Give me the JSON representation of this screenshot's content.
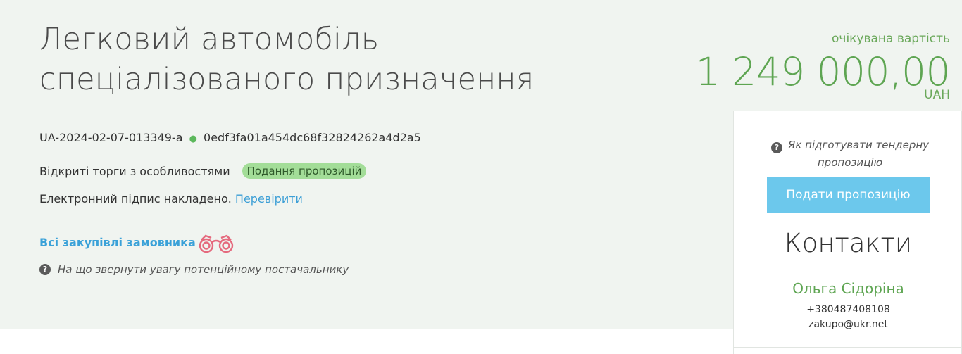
{
  "tender": {
    "title": "Легковий автомобіль спеціалізованого призначення",
    "tender_id": "UA-2024-02-07-013349-a",
    "separator": "●",
    "hash": "0edf3fa01a454dc68f32824262a4d2a5",
    "procedure_type": "Відкриті торги з особливостями",
    "status_badge": "Подання пропозицій",
    "signature_text": "Електронний підпис накладено.",
    "verify_link": "Перевірити",
    "all_purchases_link": "Всі закупівлі замовника",
    "attention_text": "На що звернути увагу потенційному постачальнику"
  },
  "expected_value": {
    "label": "очікувана вартість",
    "amount": "1 249 000,00",
    "currency": "UAH"
  },
  "sidebar": {
    "howto_text": "Як підготувати тендерну пропозицію",
    "submit_button": "Подати пропозицію",
    "contacts_title": "Контакти",
    "contact_name": "Ольга Сідоріна",
    "contact_phone": "+380487408108",
    "contact_email": "zakupo@ukr.net"
  },
  "icons": {
    "question": "question-circle-icon",
    "binoculars": "binoculars-icon"
  },
  "colors": {
    "accent_green": "#5ea552",
    "link_blue": "#3d9fd6",
    "button_blue": "#6cc8ec",
    "badge_green": "#a3dd98",
    "binoculars_pink": "#e56a7e"
  }
}
